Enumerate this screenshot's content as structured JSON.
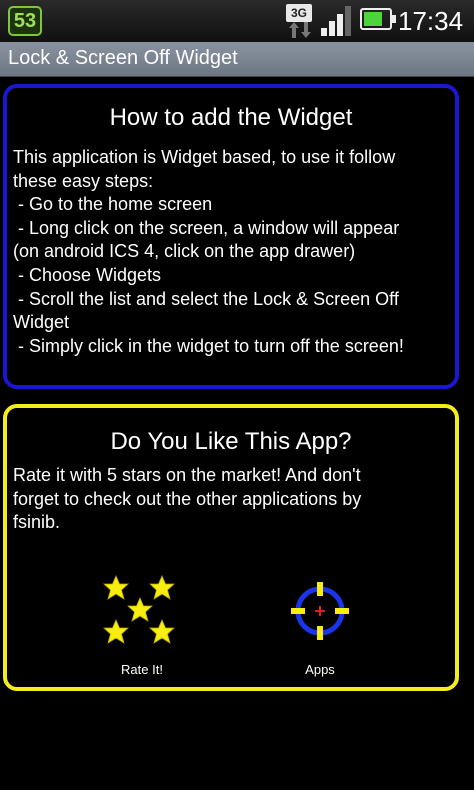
{
  "status_bar": {
    "notification_badge": "53",
    "network_type": "3G",
    "battery_level": 0.75,
    "time": "17:34",
    "colors": {
      "badge": "#7ec63d",
      "battery": "#4cd43a"
    }
  },
  "app_bar": {
    "title": "Lock & Screen Off Widget"
  },
  "how_to_panel": {
    "title": "How to add the Widget",
    "border_color": "#1a16d4",
    "lines": [
      "This application is Widget based, to use it follow",
      "these easy steps:",
      " - Go to the home screen",
      " - Long click on the screen, a window will appear",
      "(on android ICS 4, click on the app drawer)",
      " - Choose Widgets",
      " - Scroll the list and select the Lock & Screen Off",
      "Widget",
      " - Simply click in the widget to turn off the screen!"
    ]
  },
  "rate_panel": {
    "title": "Do You Like This App?",
    "border_color": "#f5ec1b",
    "lines": [
      "Rate it with 5 stars on the market! And don't",
      "forget to check out the other applications by",
      "fsinib."
    ],
    "rate_button": {
      "label": "Rate It!",
      "icon": "five-stars-icon"
    },
    "apps_button": {
      "label": "Apps",
      "icon": "crosshair-icon"
    }
  }
}
